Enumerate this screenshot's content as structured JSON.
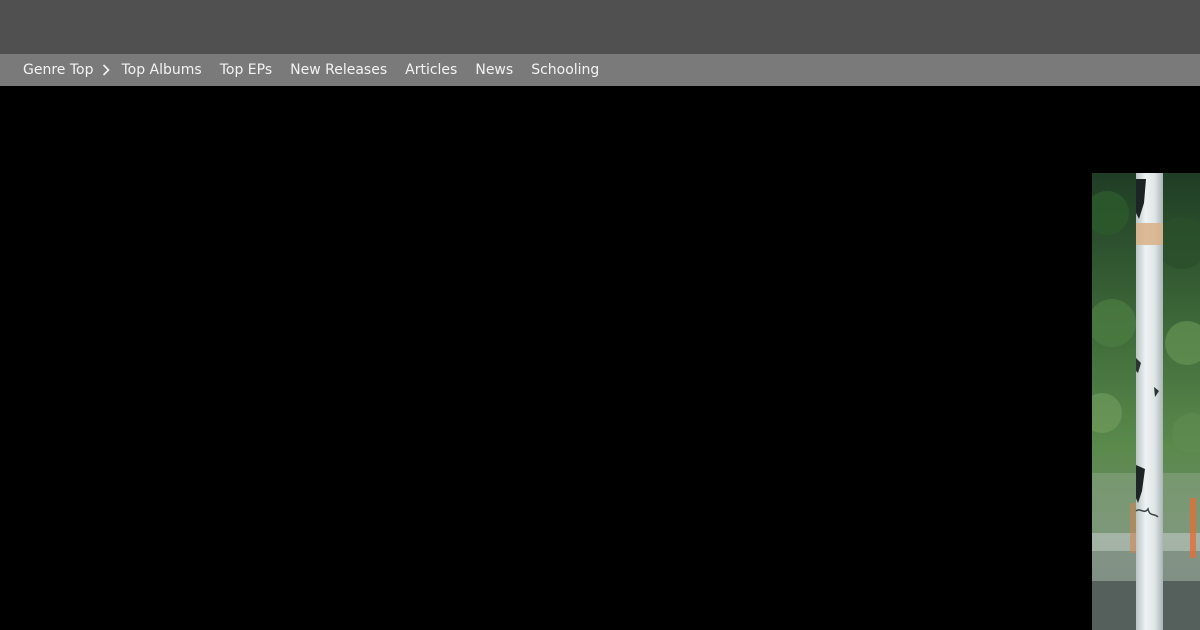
{
  "header": {
    "background": "#505050"
  },
  "subnav": {
    "background": "#7a7a7a",
    "text_color": "#f3f3f3",
    "items": [
      {
        "label": "Genre Top"
      },
      {
        "label": "Top Albums"
      },
      {
        "label": "Top EPs"
      },
      {
        "label": "New Releases"
      },
      {
        "label": "Articles"
      },
      {
        "label": "News"
      },
      {
        "label": "Schooling"
      }
    ],
    "separator_icon": "chevron-right-icon"
  },
  "main": {
    "background": "#000000",
    "hero_image": {
      "subject": "white pole with torn stickers in front of green trees"
    }
  }
}
